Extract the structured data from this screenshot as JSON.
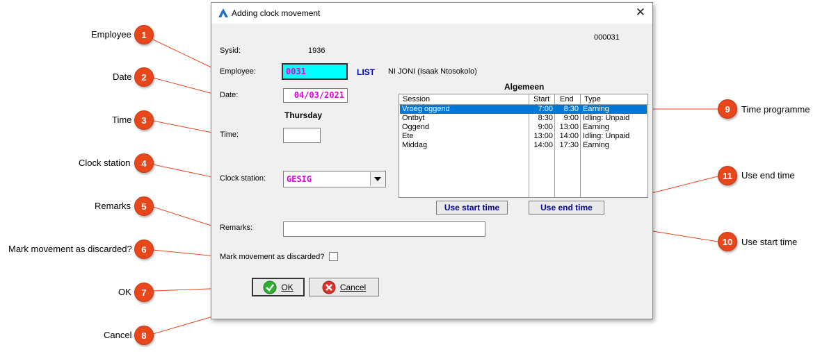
{
  "callouts": [
    {
      "num": "1",
      "label": "Employee"
    },
    {
      "num": "2",
      "label": "Date"
    },
    {
      "num": "3",
      "label": "Time"
    },
    {
      "num": "4",
      "label": "Clock station"
    },
    {
      "num": "5",
      "label": "Remarks"
    },
    {
      "num": "6",
      "label": "Mark movement as discarded?"
    },
    {
      "num": "7",
      "label": "OK"
    },
    {
      "num": "8",
      "label": "Cancel"
    },
    {
      "num": "9",
      "label": "Time programme"
    },
    {
      "num": "10",
      "label": "Use start time"
    },
    {
      "num": "11",
      "label": "Use end time"
    }
  ],
  "dialog": {
    "title": "Adding clock movement",
    "record_id": "000031",
    "sysid_label": "Sysid:",
    "sysid_value": "1936",
    "employee_label": "Employee:",
    "employee_value": "0031",
    "list_link": "LIST",
    "employee_name": "NI JONI (Isaak Ntosokolo)",
    "date_label": "Date:",
    "date_value": "04/03/2021",
    "weekday": "Thursday",
    "time_label": "Time:",
    "time_value": "",
    "clock_station_label": "Clock station:",
    "clock_station_value": "GESIG",
    "remarks_label": "Remarks:",
    "remarks_value": "",
    "discard_label": "Mark movement as discarded?",
    "ok_label": "OK",
    "cancel_label": "Cancel",
    "use_start_label": "Use start time",
    "use_end_label": "Use end time",
    "programme_title": "Algemeen",
    "grid_headers": {
      "session": "Session",
      "start": "Start",
      "end": "End",
      "type": "Type"
    },
    "sessions": [
      {
        "session": "Vroeg oggend",
        "start": "7:00",
        "end": "8:30",
        "type": "Earning"
      },
      {
        "session": "Ontbyt",
        "start": "8:30",
        "end": "9:00",
        "type": "Idling: Unpaid"
      },
      {
        "session": "Oggend",
        "start": "9:00",
        "end": "13:00",
        "type": "Earning"
      },
      {
        "session": "Ete",
        "start": "13:00",
        "end": "14:00",
        "type": "Idling: Unpaid"
      },
      {
        "session": "Middag",
        "start": "14:00",
        "end": "17:30",
        "type": "Earning"
      }
    ]
  },
  "colors": {
    "badge": "#e8471c",
    "selection": "#0078d7",
    "field_text": "#e000e0",
    "link": "#0000c0",
    "employee_bg": "#00ffff"
  }
}
